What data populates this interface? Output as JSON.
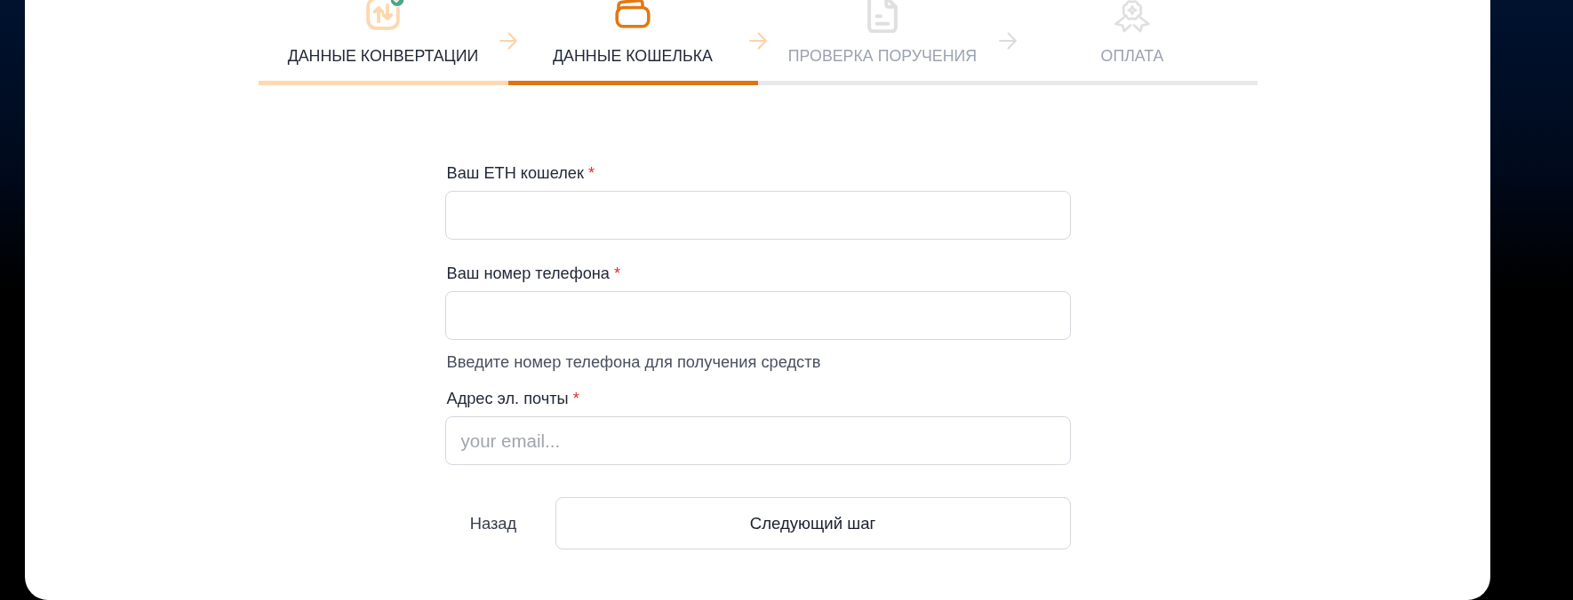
{
  "steps": [
    {
      "label": "ДАННЫЕ КОНВЕРТАЦИИ",
      "done": true,
      "selected": false
    },
    {
      "label": "ДАННЫЕ КОШЕЛЬКА",
      "done": false,
      "selected": true
    },
    {
      "label": "ПРОВЕРКА ПОРУЧЕНИЯ",
      "done": false,
      "selected": false
    },
    {
      "label": "ОПЛАТА",
      "done": false,
      "selected": false
    }
  ],
  "form": {
    "fields": [
      {
        "label": "Ваш ETH кошелек",
        "required_mark": "*"
      },
      {
        "label": "Ваш номер телефона",
        "required_mark": "*",
        "help": "Введите номер телефона для получения средств"
      },
      {
        "label": "Адрес эл. почты",
        "required_mark": "*",
        "placeholder": "your email..."
      }
    ],
    "back_button": "Назад",
    "next_button": "Следующий шаг"
  }
}
